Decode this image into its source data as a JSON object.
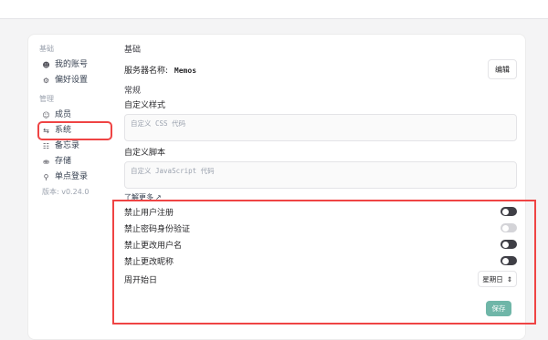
{
  "sidebar": {
    "basic_label": "基础",
    "items_basic": [
      {
        "label": "我的账号",
        "icon": "user-icon"
      },
      {
        "label": "偏好设置",
        "icon": "gear-icon"
      }
    ],
    "admin_label": "管理",
    "items_admin": [
      {
        "label": "成员",
        "icon": "users-icon"
      },
      {
        "label": "系统",
        "icon": "sliders-icon"
      },
      {
        "label": "备忘录",
        "icon": "memo-icon"
      },
      {
        "label": "存储",
        "icon": "database-icon"
      },
      {
        "label": "单点登录",
        "icon": "key-icon"
      }
    ],
    "version": "版本: v0.24.0"
  },
  "main": {
    "basic_heading": "基础",
    "server_name_label": "服务器名称:",
    "server_name_value": "Memos",
    "edit_button": "编辑",
    "general_heading": "常规",
    "custom_style_label": "自定义样式",
    "custom_style_placeholder": "自定义 CSS 代码",
    "custom_script_label": "自定义脚本",
    "custom_script_placeholder": "自定义 JavaScript 代码",
    "learn_more": "了解更多",
    "toggles": [
      {
        "label": "禁止用户注册",
        "on": true
      },
      {
        "label": "禁止密码身份验证",
        "on": false
      },
      {
        "label": "禁止更改用户名",
        "on": true
      },
      {
        "label": "禁止更改昵称",
        "on": true
      }
    ],
    "week_start_label": "周开始日",
    "week_start_value": "星期日",
    "save_button": "保存"
  },
  "colors": {
    "accent": "#6fb6a8",
    "highlight": "#ef4444"
  }
}
